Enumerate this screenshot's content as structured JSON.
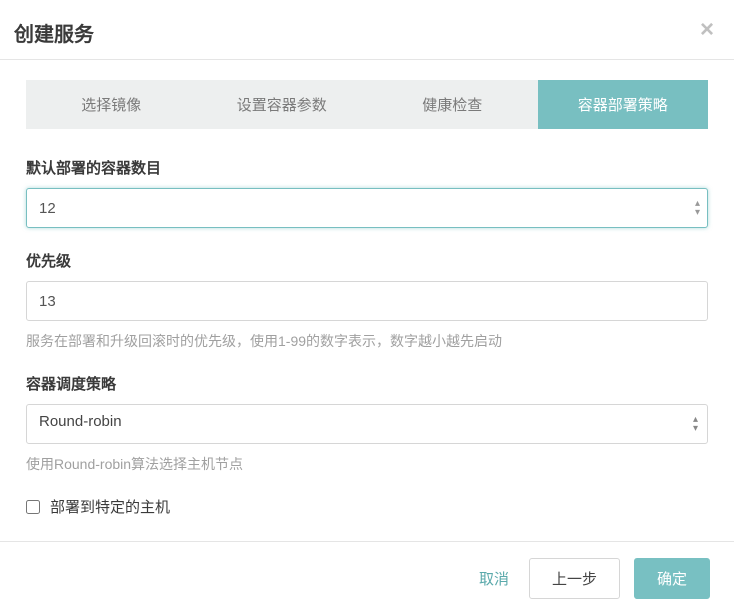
{
  "modal": {
    "title": "创建服务"
  },
  "tabs": [
    {
      "label": "选择镜像"
    },
    {
      "label": "设置容器参数"
    },
    {
      "label": "健康检查"
    },
    {
      "label": "容器部署策略"
    }
  ],
  "form": {
    "container_count": {
      "label": "默认部署的容器数目",
      "value": "12"
    },
    "priority": {
      "label": "优先级",
      "value": "13",
      "help": "服务在部署和升级回滚时的优先级，使用1-99的数字表示，数字越小越先启动"
    },
    "schedule": {
      "label": "容器调度策略",
      "value": "Round-robin",
      "help": "使用Round-robin算法选择主机节点"
    },
    "deploy_specific": {
      "label": "部署到特定的主机"
    }
  },
  "footer": {
    "cancel": "取消",
    "prev": "上一步",
    "confirm": "确定"
  }
}
